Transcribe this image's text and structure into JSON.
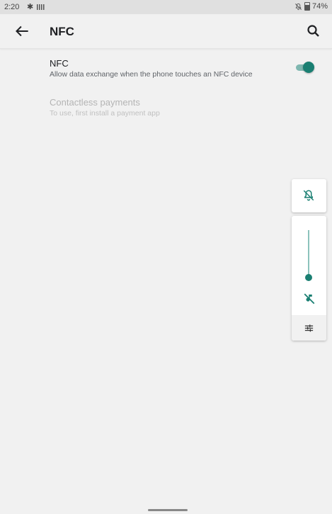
{
  "status_bar": {
    "time": "2:20",
    "battery": "74%",
    "icons": [
      "settings-icon",
      "barcode-icon",
      "ring-muted-icon",
      "battery-icon"
    ]
  },
  "app_bar": {
    "title": "NFC",
    "icons": [
      "back-arrow-icon",
      "search-icon"
    ]
  },
  "preferences": [
    {
      "title": "NFC",
      "summary": "Allow data exchange when the phone touches an NFC device",
      "toggle_on": true,
      "enabled": true
    },
    {
      "title": "Contactless payments",
      "summary": "To use, first install a payment app",
      "enabled": false
    }
  ],
  "volume_panel": {
    "ringer_icon": "ring-muted-icon",
    "stream_icon": "media-muted-icon",
    "settings_icon": "sliders-icon",
    "level": 0
  },
  "colors": {
    "accent": "#1a7f72",
    "background": "#f1f1f1",
    "status_bar": "#e0e0e0"
  }
}
